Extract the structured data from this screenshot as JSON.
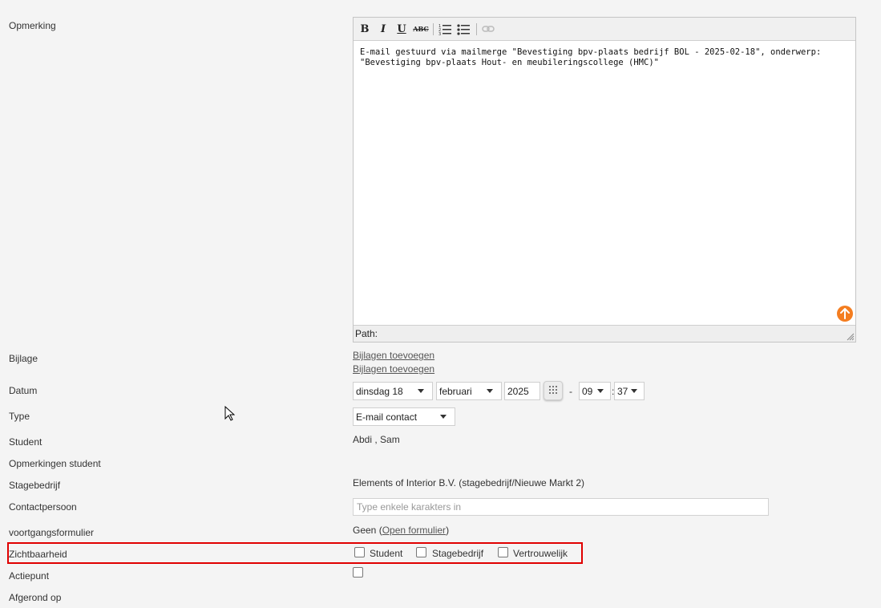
{
  "labels": {
    "opmerking": "Opmerking",
    "bijlage": "Bijlage",
    "datum": "Datum",
    "type": "Type",
    "student": "Student",
    "opmerkingen_student": "Opmerkingen student",
    "stagebedrijf": "Stagebedrijf",
    "contactpersoon": "Contactpersoon",
    "voortgangsformulier": "voortgangsformulier",
    "zichtbaarheid": "Zichtbaarheid",
    "actiepunt": "Actiepunt",
    "afgerond_op": "Afgerond op"
  },
  "editor": {
    "toolbar": {
      "bold": "B",
      "italic": "I",
      "underline": "U",
      "strike": "ABC"
    },
    "content": "E-mail gestuurd via mailmerge \"Bevestiging bpv-plaats bedrijf BOL - 2025-02-18\", onderwerp: \"Bevestiging bpv-plaats Hout- en meubileringscollege (HMC)\"",
    "path_label": "Path:"
  },
  "bijlage": {
    "link1": "Bijlagen toevoegen",
    "link2": "Bijlagen toevoegen"
  },
  "datum": {
    "day": "dinsdag 18",
    "month": "februari",
    "year": "2025",
    "dash": "-",
    "hour": "09",
    "colon": ":",
    "minute": "37"
  },
  "type": {
    "value": "E-mail contact"
  },
  "student": {
    "value": "Abdi , Sam"
  },
  "stagebedrijf": {
    "value": "Elements of Interior B.V. (stagebedrijf/Nieuwe Markt 2)"
  },
  "contactpersoon": {
    "placeholder": "Type enkele karakters in"
  },
  "voortgang": {
    "prefix": "Geen (",
    "link": "Open formulier",
    "suffix": ")"
  },
  "zichtbaarheid": {
    "opt1": "Student",
    "opt2": "Stagebedrijf",
    "opt3": "Vertrouwelijk"
  },
  "colors": {
    "accent_orange": "#f47d20",
    "highlight_red": "#e00000"
  }
}
